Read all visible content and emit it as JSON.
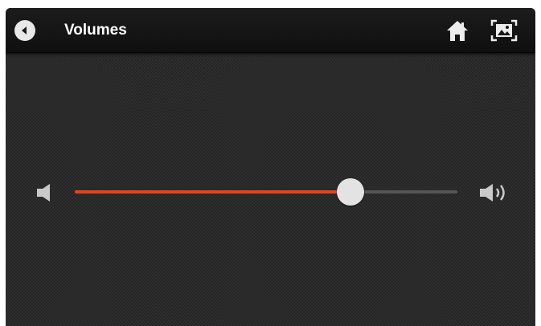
{
  "header": {
    "title": "Volumes",
    "back_icon": "back-arrow-icon",
    "home_icon": "home-icon",
    "screenshot_icon": "screenshot-icon"
  },
  "volume": {
    "level": 0.72,
    "min_icon": "volume-low-icon",
    "max_icon": "volume-high-icon"
  },
  "colors": {
    "accent": "#e8431a",
    "track": "#555555",
    "thumb": "#e3e3e3",
    "background": "#262626",
    "titlebar": "#141414"
  }
}
